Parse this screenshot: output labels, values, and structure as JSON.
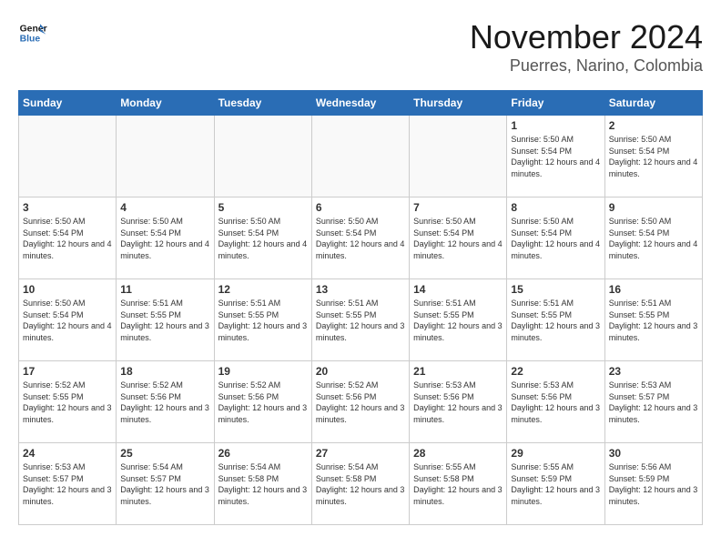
{
  "logo": {
    "line1": "General",
    "line2": "Blue"
  },
  "header": {
    "month": "November 2024",
    "location": "Puerres, Narino, Colombia"
  },
  "weekdays": [
    "Sunday",
    "Monday",
    "Tuesday",
    "Wednesday",
    "Thursday",
    "Friday",
    "Saturday"
  ],
  "weeks": [
    [
      {
        "day": "",
        "info": ""
      },
      {
        "day": "",
        "info": ""
      },
      {
        "day": "",
        "info": ""
      },
      {
        "day": "",
        "info": ""
      },
      {
        "day": "",
        "info": ""
      },
      {
        "day": "1",
        "info": "Sunrise: 5:50 AM\nSunset: 5:54 PM\nDaylight: 12 hours and 4 minutes."
      },
      {
        "day": "2",
        "info": "Sunrise: 5:50 AM\nSunset: 5:54 PM\nDaylight: 12 hours and 4 minutes."
      }
    ],
    [
      {
        "day": "3",
        "info": "Sunrise: 5:50 AM\nSunset: 5:54 PM\nDaylight: 12 hours and 4 minutes."
      },
      {
        "day": "4",
        "info": "Sunrise: 5:50 AM\nSunset: 5:54 PM\nDaylight: 12 hours and 4 minutes."
      },
      {
        "day": "5",
        "info": "Sunrise: 5:50 AM\nSunset: 5:54 PM\nDaylight: 12 hours and 4 minutes."
      },
      {
        "day": "6",
        "info": "Sunrise: 5:50 AM\nSunset: 5:54 PM\nDaylight: 12 hours and 4 minutes."
      },
      {
        "day": "7",
        "info": "Sunrise: 5:50 AM\nSunset: 5:54 PM\nDaylight: 12 hours and 4 minutes."
      },
      {
        "day": "8",
        "info": "Sunrise: 5:50 AM\nSunset: 5:54 PM\nDaylight: 12 hours and 4 minutes."
      },
      {
        "day": "9",
        "info": "Sunrise: 5:50 AM\nSunset: 5:54 PM\nDaylight: 12 hours and 4 minutes."
      }
    ],
    [
      {
        "day": "10",
        "info": "Sunrise: 5:50 AM\nSunset: 5:54 PM\nDaylight: 12 hours and 4 minutes."
      },
      {
        "day": "11",
        "info": "Sunrise: 5:51 AM\nSunset: 5:55 PM\nDaylight: 12 hours and 3 minutes."
      },
      {
        "day": "12",
        "info": "Sunrise: 5:51 AM\nSunset: 5:55 PM\nDaylight: 12 hours and 3 minutes."
      },
      {
        "day": "13",
        "info": "Sunrise: 5:51 AM\nSunset: 5:55 PM\nDaylight: 12 hours and 3 minutes."
      },
      {
        "day": "14",
        "info": "Sunrise: 5:51 AM\nSunset: 5:55 PM\nDaylight: 12 hours and 3 minutes."
      },
      {
        "day": "15",
        "info": "Sunrise: 5:51 AM\nSunset: 5:55 PM\nDaylight: 12 hours and 3 minutes."
      },
      {
        "day": "16",
        "info": "Sunrise: 5:51 AM\nSunset: 5:55 PM\nDaylight: 12 hours and 3 minutes."
      }
    ],
    [
      {
        "day": "17",
        "info": "Sunrise: 5:52 AM\nSunset: 5:55 PM\nDaylight: 12 hours and 3 minutes."
      },
      {
        "day": "18",
        "info": "Sunrise: 5:52 AM\nSunset: 5:56 PM\nDaylight: 12 hours and 3 minutes."
      },
      {
        "day": "19",
        "info": "Sunrise: 5:52 AM\nSunset: 5:56 PM\nDaylight: 12 hours and 3 minutes."
      },
      {
        "day": "20",
        "info": "Sunrise: 5:52 AM\nSunset: 5:56 PM\nDaylight: 12 hours and 3 minutes."
      },
      {
        "day": "21",
        "info": "Sunrise: 5:53 AM\nSunset: 5:56 PM\nDaylight: 12 hours and 3 minutes."
      },
      {
        "day": "22",
        "info": "Sunrise: 5:53 AM\nSunset: 5:56 PM\nDaylight: 12 hours and 3 minutes."
      },
      {
        "day": "23",
        "info": "Sunrise: 5:53 AM\nSunset: 5:57 PM\nDaylight: 12 hours and 3 minutes."
      }
    ],
    [
      {
        "day": "24",
        "info": "Sunrise: 5:53 AM\nSunset: 5:57 PM\nDaylight: 12 hours and 3 minutes."
      },
      {
        "day": "25",
        "info": "Sunrise: 5:54 AM\nSunset: 5:57 PM\nDaylight: 12 hours and 3 minutes."
      },
      {
        "day": "26",
        "info": "Sunrise: 5:54 AM\nSunset: 5:58 PM\nDaylight: 12 hours and 3 minutes."
      },
      {
        "day": "27",
        "info": "Sunrise: 5:54 AM\nSunset: 5:58 PM\nDaylight: 12 hours and 3 minutes."
      },
      {
        "day": "28",
        "info": "Sunrise: 5:55 AM\nSunset: 5:58 PM\nDaylight: 12 hours and 3 minutes."
      },
      {
        "day": "29",
        "info": "Sunrise: 5:55 AM\nSunset: 5:59 PM\nDaylight: 12 hours and 3 minutes."
      },
      {
        "day": "30",
        "info": "Sunrise: 5:56 AM\nSunset: 5:59 PM\nDaylight: 12 hours and 3 minutes."
      }
    ]
  ]
}
